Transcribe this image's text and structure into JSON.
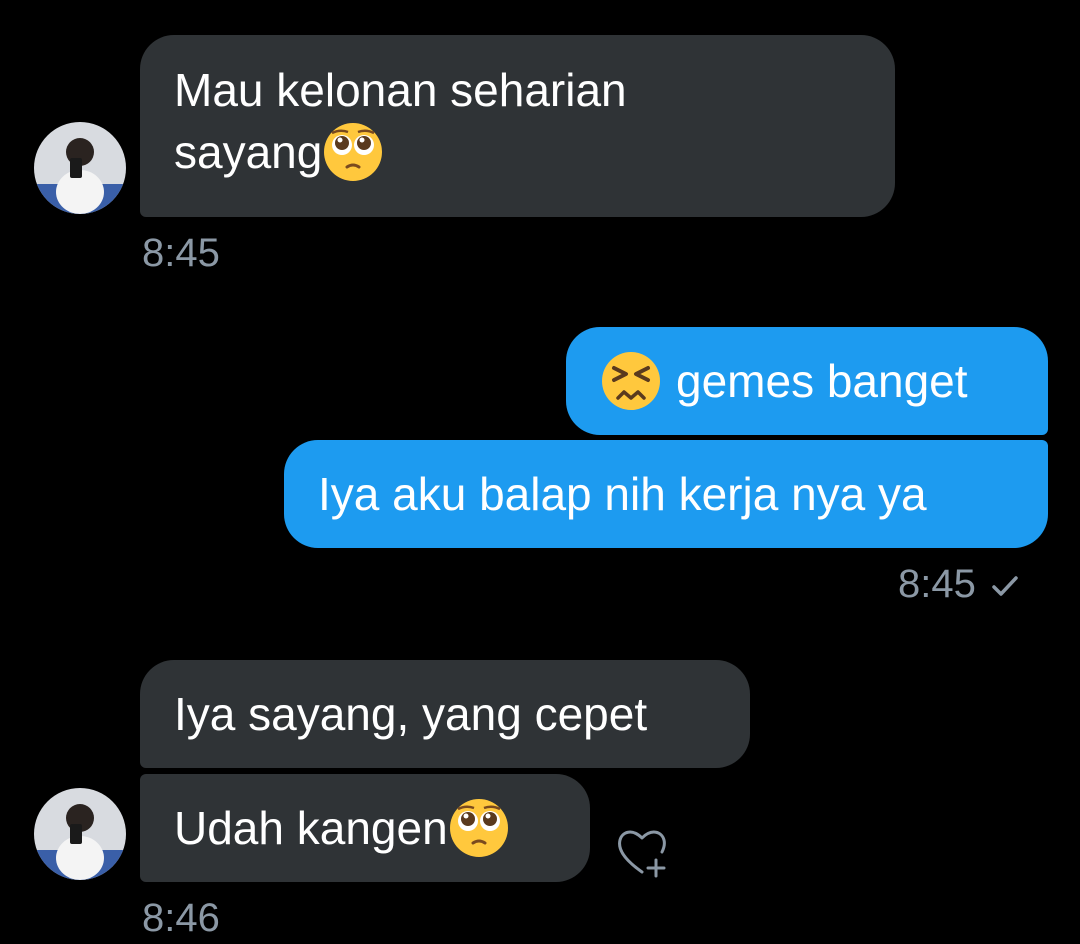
{
  "messages": {
    "m1": {
      "line1": "Mau kelonan seharian",
      "line2": "sayang",
      "line2_emoji": "pleading-face-emoji",
      "time": "8:45"
    },
    "m2": {
      "emoji": "persevering-face-emoji",
      "text": "gemes banget"
    },
    "m3": {
      "text": "Iya aku balap nih kerja nya ya",
      "time": "8:45",
      "status_icon": "checkmark-icon"
    },
    "m4": {
      "text": "Iya sayang, yang cepet"
    },
    "m5": {
      "text": "Udah kangen",
      "emoji": "pleading-face-emoji",
      "time": "8:46",
      "reaction_icon": "heart-plus-icon"
    }
  },
  "colors": {
    "background": "#000000",
    "incoming_bubble": "#2f3336",
    "outgoing_bubble": "#1d9bf0",
    "timestamp": "#8b98a5",
    "emoji_face": "#ffc83d"
  }
}
